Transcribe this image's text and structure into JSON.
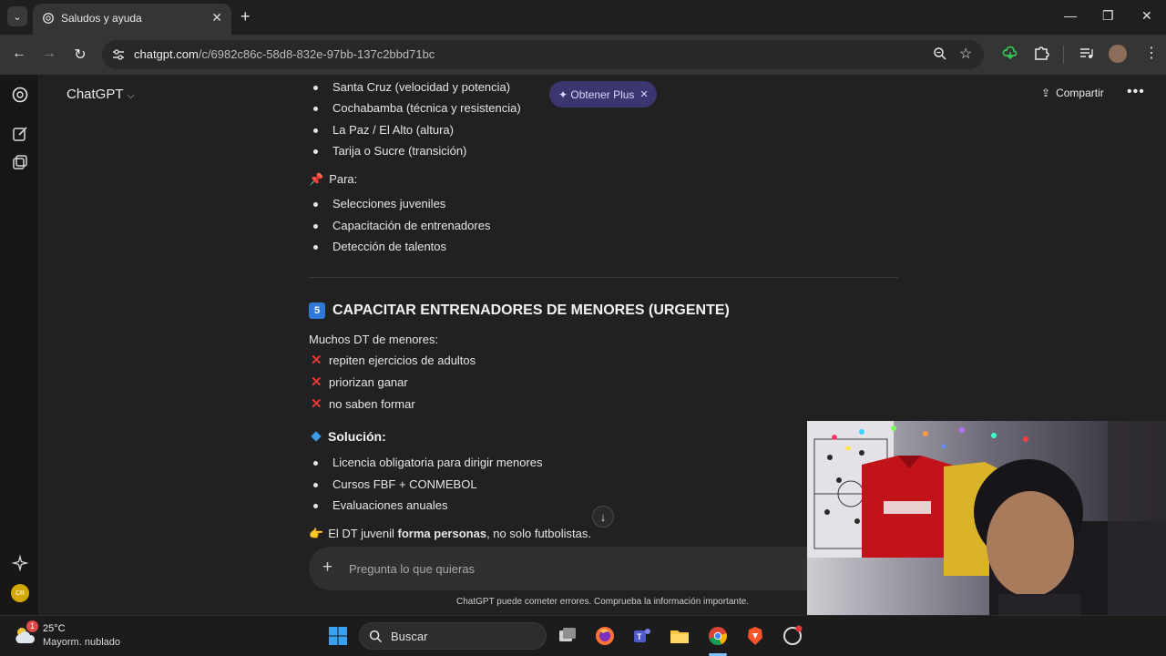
{
  "browser": {
    "tab_title": "Saludos y ayuda",
    "url_host": "chatgpt.com",
    "url_path": "/c/6982c86c-58d8-832e-97bb-137c2bbd71bc"
  },
  "app": {
    "model_name": "ChatGPT",
    "upgrade_label": "✦ Obtener Plus",
    "share_label": "Compartir",
    "avatar_initials": "CR"
  },
  "message": {
    "list_a": [
      "Santa Cruz (velocidad y potencia)",
      "Cochabamba (técnica y resistencia)",
      "La Paz / El Alto (altura)",
      "Tarija o Sucre (transición)"
    ],
    "para_label": "Para:",
    "list_b": [
      "Selecciones juveniles",
      "Capacitación de entrenadores",
      "Detección de talentos"
    ],
    "section_number": "5",
    "section_title": "CAPACITAR ENTRENADORES DE MENORES (URGENTE)",
    "intro": "Muchos DT de menores:",
    "problems": [
      "repiten ejercicios de adultos",
      "priorizan ganar",
      "no saben formar"
    ],
    "solution_title": "Solución:",
    "solutions": [
      "Licencia obligatoria para dirigir menores",
      "Cursos FBF + CONMEBOL",
      "Evaluaciones anuales"
    ],
    "closing_pre": "El DT juvenil ",
    "closing_bold": "forma personas",
    "closing_post": ", no solo futbolistas."
  },
  "composer": {
    "placeholder": "Pregunta lo que quieras",
    "disclaimer": "ChatGPT puede cometer errores. Comprueba la información importante."
  },
  "taskbar": {
    "temperature": "25°C",
    "weather": "Mayorm. nublado",
    "weather_badge": "1",
    "search_label": "Buscar"
  }
}
